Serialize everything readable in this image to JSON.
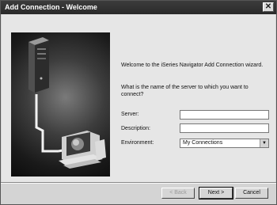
{
  "window": {
    "title": "Add Connection - Welcome",
    "close_glyph": "✕"
  },
  "welcome_text": "Welcome to the iSeries Navigator Add Connection wizard.",
  "question_text": "What is the name of the server to which you want to connect?",
  "form": {
    "server_label": "Server:",
    "server_value": "",
    "description_label": "Description:",
    "description_value": "",
    "environment_label": "Environment:",
    "environment_value": "My Connections"
  },
  "buttons": {
    "back": "< Back",
    "next": "Next >",
    "cancel": "Cancel"
  },
  "icons": {
    "illustration": "server-to-computer-connection",
    "dropdown": "chevron-down-icon"
  }
}
